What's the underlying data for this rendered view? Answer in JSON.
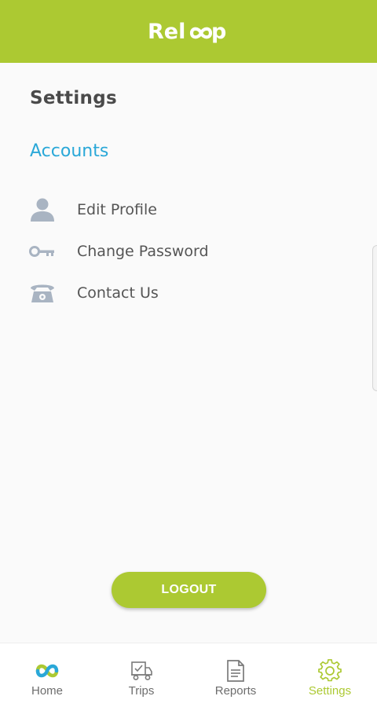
{
  "header": {
    "logo_text": "Reloop",
    "background": "#acc932"
  },
  "page": {
    "title": "Settings"
  },
  "accounts_section": {
    "title": "Accounts",
    "color": "#2aa8d8",
    "items": [
      {
        "label": "Edit Profile",
        "icon": "user-icon"
      },
      {
        "label": "Change Password",
        "icon": "key-icon"
      },
      {
        "label": "Contact Us",
        "icon": "telephone-icon"
      }
    ]
  },
  "logout": {
    "label": "LOGOUT"
  },
  "bottom_nav": {
    "active": "Settings",
    "accent": "#acc932",
    "items": [
      {
        "label": "Home",
        "icon": "reloop-logo-icon"
      },
      {
        "label": "Trips",
        "icon": "truck-icon"
      },
      {
        "label": "Reports",
        "icon": "document-icon"
      },
      {
        "label": "Settings",
        "icon": "gear-icon"
      }
    ]
  }
}
